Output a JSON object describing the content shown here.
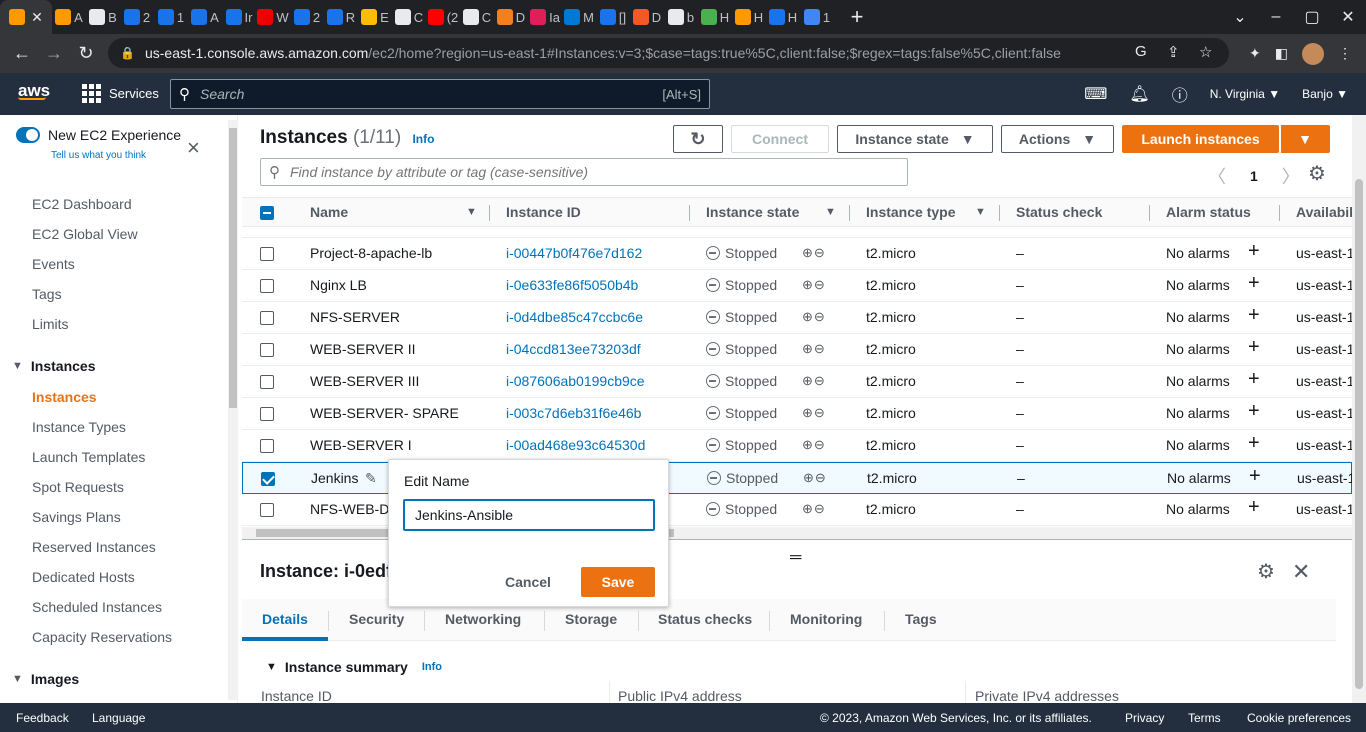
{
  "browser": {
    "tabs": [
      {
        "letter": "",
        "color": "#ff9900",
        "active": true
      },
      {
        "letter": "A",
        "color": "#ff9900"
      },
      {
        "letter": "B",
        "color": "#e8eaed"
      },
      {
        "letter": "2",
        "color": "#1a73e8"
      },
      {
        "letter": "1",
        "color": "#1a73e8"
      },
      {
        "letter": "A",
        "color": "#1a73e8"
      },
      {
        "letter": "Ir",
        "color": "#1a73e8"
      },
      {
        "letter": "W",
        "color": "#ee0000"
      },
      {
        "letter": "2",
        "color": "#1a73e8"
      },
      {
        "letter": "R",
        "color": "#1a73e8"
      },
      {
        "letter": "E",
        "color": "#fbbc04"
      },
      {
        "letter": "C",
        "color": "#e8eaed"
      },
      {
        "letter": "(2",
        "color": "#ff0000"
      },
      {
        "letter": "C",
        "color": "#e8eaed"
      },
      {
        "letter": "D",
        "color": "#f38020"
      },
      {
        "letter": "Ia",
        "color": "#e01e5a"
      },
      {
        "letter": "M",
        "color": "#0078d4"
      },
      {
        "letter": "[]",
        "color": "#1a73e8"
      },
      {
        "letter": "D",
        "color": "#f05a28"
      },
      {
        "letter": "b",
        "color": "#e8eaed"
      },
      {
        "letter": "H",
        "color": "#4caf50"
      },
      {
        "letter": "H",
        "color": "#ff9900"
      },
      {
        "letter": "H",
        "color": "#1a73e8"
      },
      {
        "letter": "1",
        "color": "#4285f4"
      }
    ],
    "url_host": "us-east-1.console.aws.amazon.com",
    "url_path": "/ec2/home?region=us-east-1#Instances:v=3;$case=tags:true%5C,client:false;$regex=tags:false%5C,client:false"
  },
  "aws_nav": {
    "logo": "aws",
    "services": "Services",
    "search_placeholder": "Search",
    "search_shortcut": "[Alt+S]",
    "region": "N. Virginia",
    "user": "Banjo"
  },
  "sidebar": {
    "new_experience": "New EC2 Experience",
    "tell_us": "Tell us what you think",
    "items_top": [
      "EC2 Dashboard",
      "EC2 Global View",
      "Events",
      "Tags",
      "Limits"
    ],
    "instances_header": "Instances",
    "instances_items": [
      "Instances",
      "Instance Types",
      "Launch Templates",
      "Spot Requests",
      "Savings Plans",
      "Reserved Instances",
      "Dedicated Hosts",
      "Scheduled Instances",
      "Capacity Reservations"
    ],
    "images_header": "Images"
  },
  "main": {
    "title": "Instances",
    "count": "(1/11)",
    "info": "Info",
    "connect": "Connect",
    "instance_state": "Instance state",
    "actions": "Actions",
    "launch": "Launch instances",
    "filter_placeholder": "Find instance by attribute or tag (case-sensitive)",
    "page": "1",
    "columns": [
      "Name",
      "Instance ID",
      "Instance state",
      "Instance type",
      "Status check",
      "Alarm status",
      "Availabil"
    ],
    "rows": [
      {
        "name": "Project-8-apache-lb",
        "id": "i-00447b0f476e7d162",
        "state": "Stopped",
        "type": "t2.micro",
        "status": "–",
        "alarm": "No alarms",
        "az": "us-east-1",
        "checked": false
      },
      {
        "name": "Nginx LB",
        "id": "i-0e633fe86f5050b4b",
        "state": "Stopped",
        "type": "t2.micro",
        "status": "–",
        "alarm": "No alarms",
        "az": "us-east-1",
        "checked": false
      },
      {
        "name": "NFS-SERVER",
        "id": "i-0d4dbe85c47ccbc6e",
        "state": "Stopped",
        "type": "t2.micro",
        "status": "–",
        "alarm": "No alarms",
        "az": "us-east-1",
        "checked": false
      },
      {
        "name": "WEB-SERVER II",
        "id": "i-04ccd813ee73203df",
        "state": "Stopped",
        "type": "t2.micro",
        "status": "–",
        "alarm": "No alarms",
        "az": "us-east-1",
        "checked": false
      },
      {
        "name": "WEB-SERVER III",
        "id": "i-087606ab0199cb9ce",
        "state": "Stopped",
        "type": "t2.micro",
        "status": "–",
        "alarm": "No alarms",
        "az": "us-east-1",
        "checked": false
      },
      {
        "name": "WEB-SERVER- SPARE",
        "id": "i-003c7d6eb31f6e46b",
        "state": "Stopped",
        "type": "t2.micro",
        "status": "–",
        "alarm": "No alarms",
        "az": "us-east-1",
        "checked": false
      },
      {
        "name": "WEB-SERVER I",
        "id": "i-00ad468e93c64530d",
        "state": "Stopped",
        "type": "t2.micro",
        "status": "–",
        "alarm": "No alarms",
        "az": "us-east-1",
        "checked": false
      },
      {
        "name": "Jenkins",
        "id": "",
        "state": "Stopped",
        "type": "t2.micro",
        "status": "–",
        "alarm": "No alarms",
        "az": "us-east-1",
        "checked": true
      },
      {
        "name": "NFS-WEB-DE",
        "id": "",
        "state": "Stopped",
        "type": "t2.micro",
        "status": "–",
        "alarm": "No alarms",
        "az": "us-east-1",
        "checked": false
      }
    ]
  },
  "detail": {
    "title": "Instance: i-0edf",
    "tabs": [
      "Details",
      "Security",
      "Networking",
      "Storage",
      "Status checks",
      "Monitoring",
      "Tags"
    ],
    "summary": "Instance summary",
    "info": "Info",
    "labels": [
      "Instance ID",
      "Public IPv4 address",
      "Private IPv4 addresses"
    ]
  },
  "popover": {
    "title": "Edit Name",
    "value": "Jenkins-Ansible",
    "cancel": "Cancel",
    "save": "Save"
  },
  "footer": {
    "feedback": "Feedback",
    "language": "Language",
    "copyright": "© 2023, Amazon Web Services, Inc. or its affiliates.",
    "privacy": "Privacy",
    "terms": "Terms",
    "cookies": "Cookie preferences"
  }
}
